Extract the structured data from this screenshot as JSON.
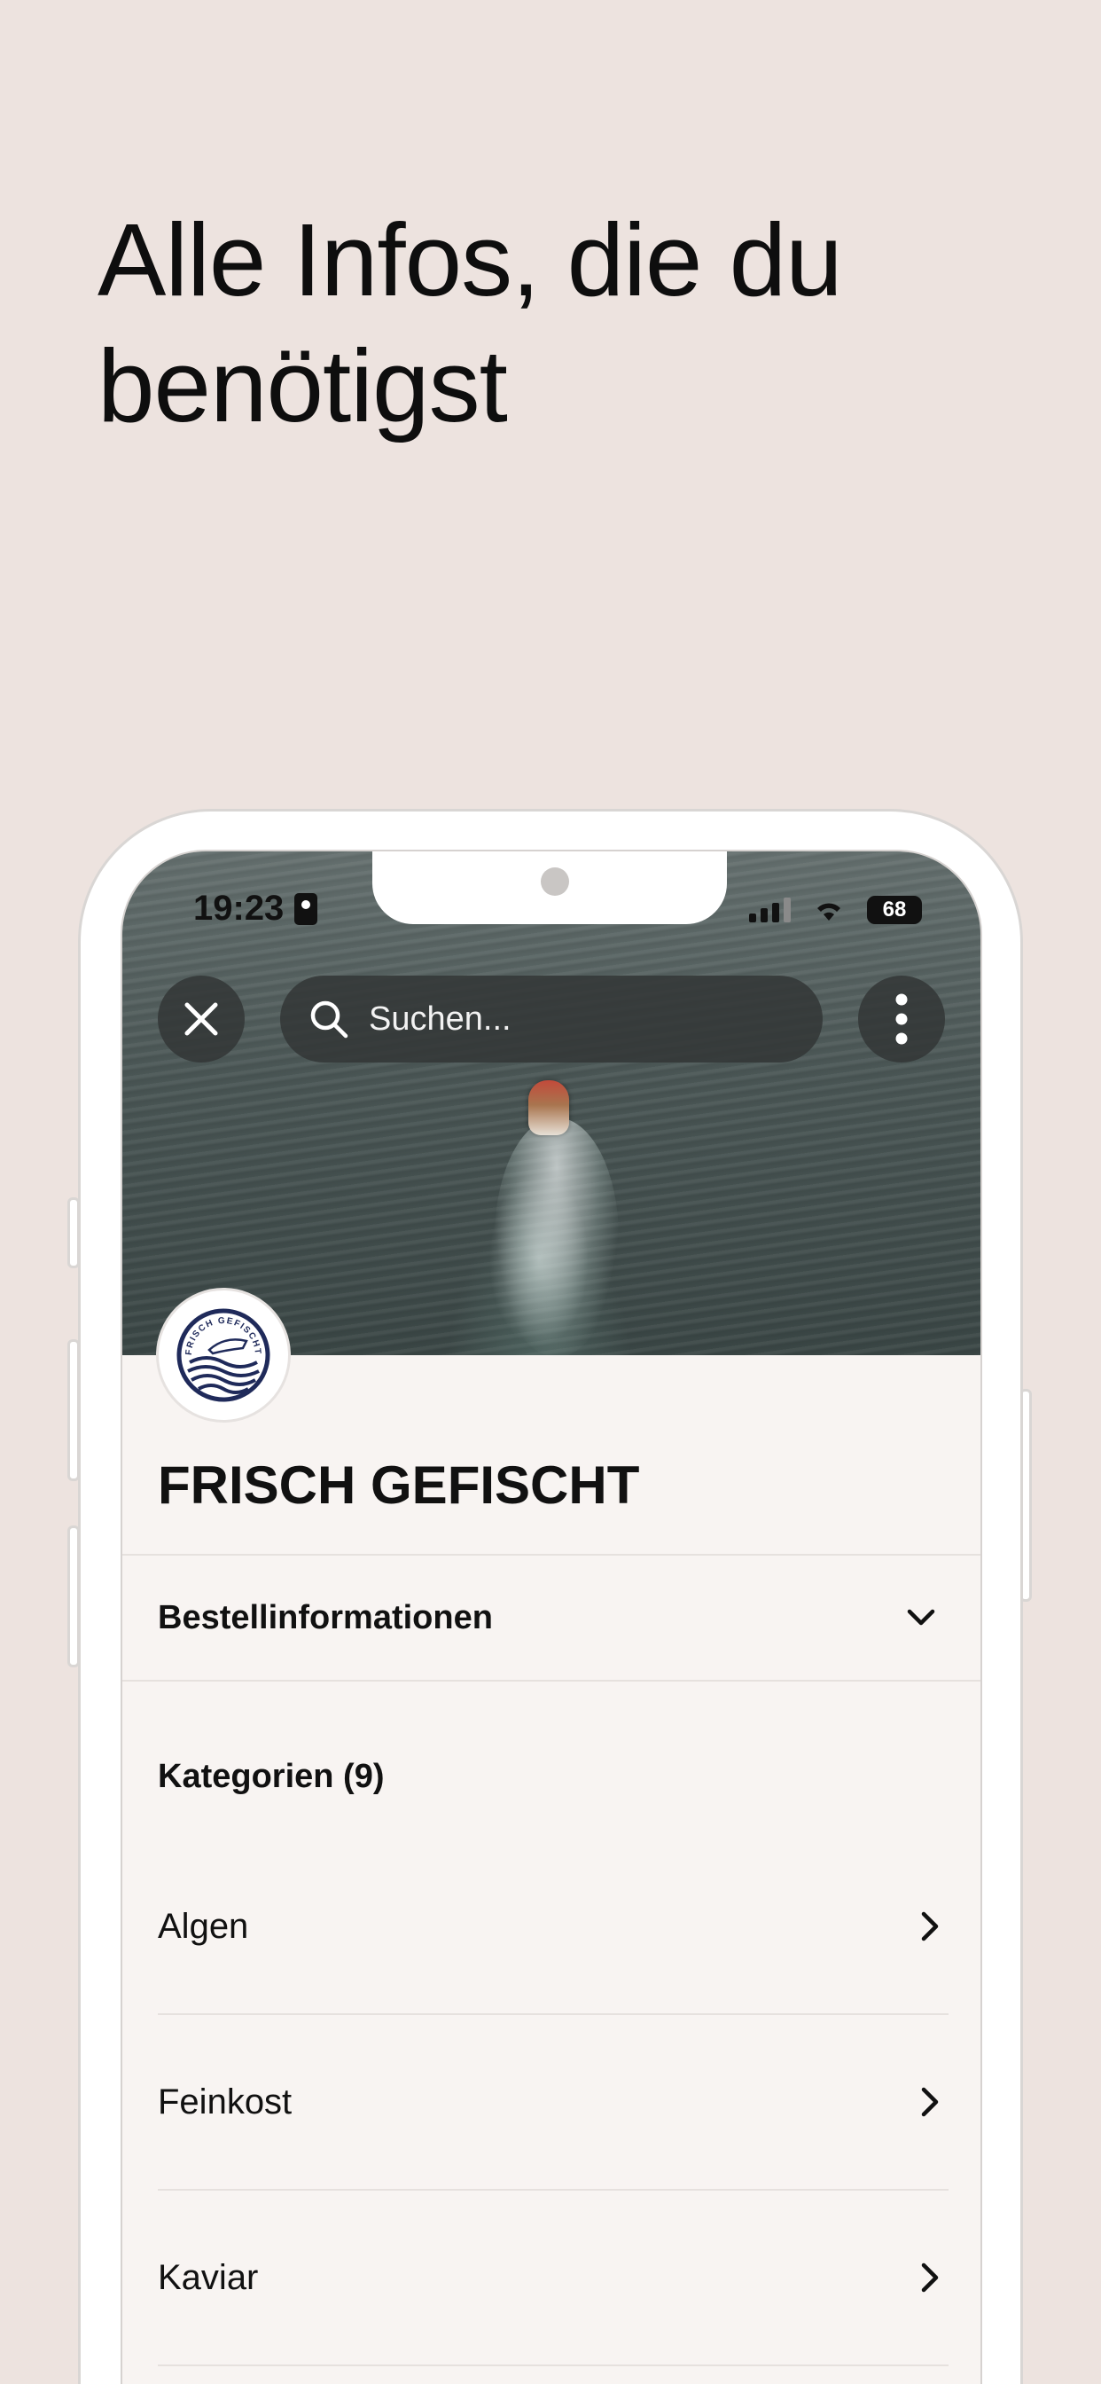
{
  "headline": "Alle Infos, die du benötigst",
  "status_bar": {
    "time": "19:23",
    "battery": "68"
  },
  "search": {
    "placeholder": "Suchen..."
  },
  "store": {
    "name": "FRISCH GEFISCHT",
    "logo_text": "FRISCH GEFISCHT"
  },
  "accordion": {
    "label": "Bestellinformationen"
  },
  "categories": {
    "heading": "Kategorien (9)",
    "items": [
      {
        "label": "Algen"
      },
      {
        "label": "Feinkost"
      },
      {
        "label": "Kaviar"
      }
    ]
  },
  "icons": {
    "close": "close-icon",
    "search": "search-icon",
    "more": "more-vertical-icon",
    "chevron_down": "chevron-down-icon",
    "chevron_right": "chevron-right-icon"
  },
  "colors": {
    "background": "#ede3df",
    "screen_background": "#f8f4f2",
    "overlay_button": "#323636",
    "logo_navy": "#1f2a5a"
  }
}
